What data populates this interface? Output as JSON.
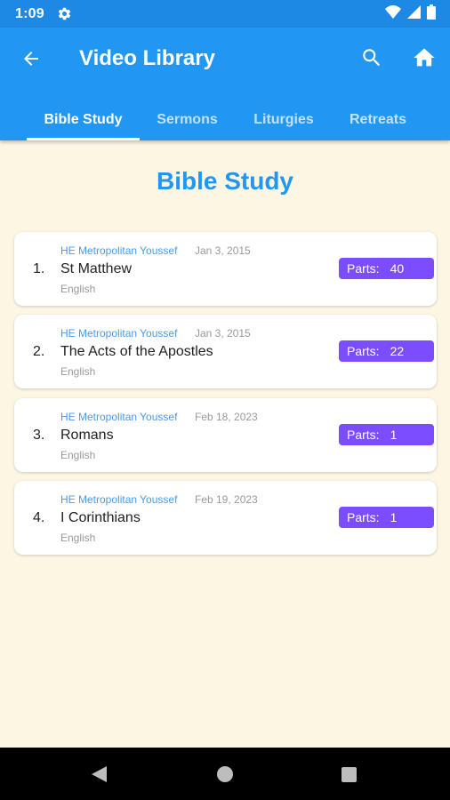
{
  "status_bar": {
    "time": "1:09",
    "icons": [
      "gear-icon",
      "wifi-icon",
      "signal-icon",
      "battery-icon"
    ]
  },
  "app_bar": {
    "title": "Video Library",
    "back_icon": "arrow-back-icon",
    "search_icon": "search-icon",
    "home_icon": "home-icon"
  },
  "tabs": [
    {
      "label": "Bible Study",
      "active": true
    },
    {
      "label": "Sermons",
      "active": false
    },
    {
      "label": "Liturgies",
      "active": false
    },
    {
      "label": "Retreats",
      "active": false
    }
  ],
  "section": {
    "title": "Bible Study"
  },
  "items": [
    {
      "index": "1.",
      "author": "HE Metropolitan Youssef",
      "date": "Jan 3, 2015",
      "title": "St Matthew",
      "language": "English",
      "parts_label": "Parts:",
      "parts": "40"
    },
    {
      "index": "2.",
      "author": "HE Metropolitan Youssef",
      "date": "Jan 3, 2015",
      "title": "The Acts of the Apostles",
      "language": "English",
      "parts_label": "Parts:",
      "parts": "22"
    },
    {
      "index": "3.",
      "author": "HE Metropolitan Youssef",
      "date": "Feb 18, 2023",
      "title": "Romans",
      "language": "English",
      "parts_label": "Parts:",
      "parts": "1"
    },
    {
      "index": "4.",
      "author": "HE Metropolitan Youssef",
      "date": "Feb 19, 2023",
      "title": "I Corinthians",
      "language": "English",
      "parts_label": "Parts:",
      "parts": "1"
    }
  ],
  "colors": {
    "primary": "#2196f3",
    "status_bar": "#1e88e5",
    "badge": "#7c4dff",
    "background": "#fdf6e3",
    "author_text": "#4a9be8"
  }
}
